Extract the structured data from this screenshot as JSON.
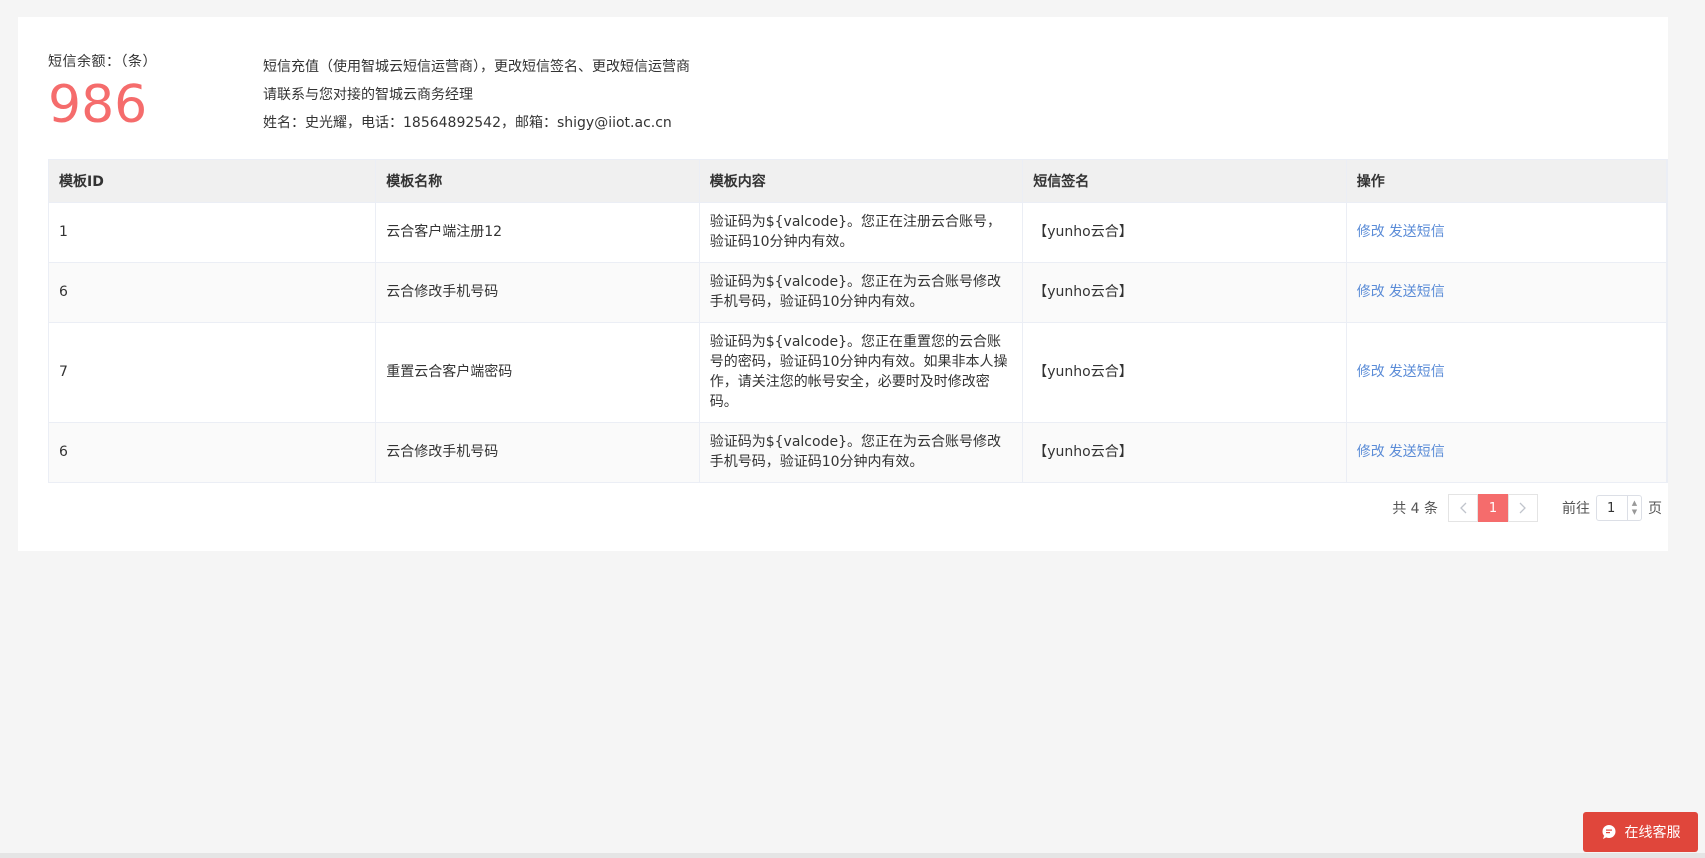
{
  "balance": {
    "label": "短信余额：（条）",
    "value": "986"
  },
  "contact": {
    "line1": "短信充值（使用智城云短信运营商），更改短信签名、更改短信运营商",
    "line2": "请联系与您对接的智城云商务经理",
    "line3": "姓名：史光耀，电话：18564892542，邮箱：shigy@iiot.ac.cn"
  },
  "table": {
    "headers": [
      "模板ID",
      "模板名称",
      "模板内容",
      "短信签名",
      "操作"
    ],
    "rows": [
      {
        "id": "1",
        "name": "云合客户端注册12",
        "content": "验证码为${valcode}。您正在注册云合账号，验证码10分钟内有效。",
        "sign": "【yunho云合】",
        "edit": "修改",
        "send": "发送短信"
      },
      {
        "id": "6",
        "name": "云合修改手机号码",
        "content": "验证码为${valcode}。您正在为云合账号修改手机号码，验证码10分钟内有效。",
        "sign": "【yunho云合】",
        "edit": "修改",
        "send": "发送短信"
      },
      {
        "id": "7",
        "name": "重置云合客户端密码",
        "content": "验证码为${valcode}。您正在重置您的云合账号的密码，验证码10分钟内有效。如果非本人操作，请关注您的帐号安全，必要时及时修改密码。",
        "sign": "【yunho云合】",
        "edit": "修改",
        "send": "发送短信"
      },
      {
        "id": "6",
        "name": "云合修改手机号码",
        "content": "验证码为${valcode}。您正在为云合账号修改手机号码，验证码10分钟内有效。",
        "sign": "【yunho云合】",
        "edit": "修改",
        "send": "发送短信"
      }
    ]
  },
  "pagination": {
    "total": "共 4 条",
    "current_page": "1",
    "goto_label": "前往",
    "goto_value": "1",
    "page_suffix": "页"
  },
  "chat": {
    "label": "在线客服"
  },
  "colors": {
    "accent": "#f56c6c",
    "link": "#5b8cd7",
    "chat_bg": "#e0463b"
  }
}
